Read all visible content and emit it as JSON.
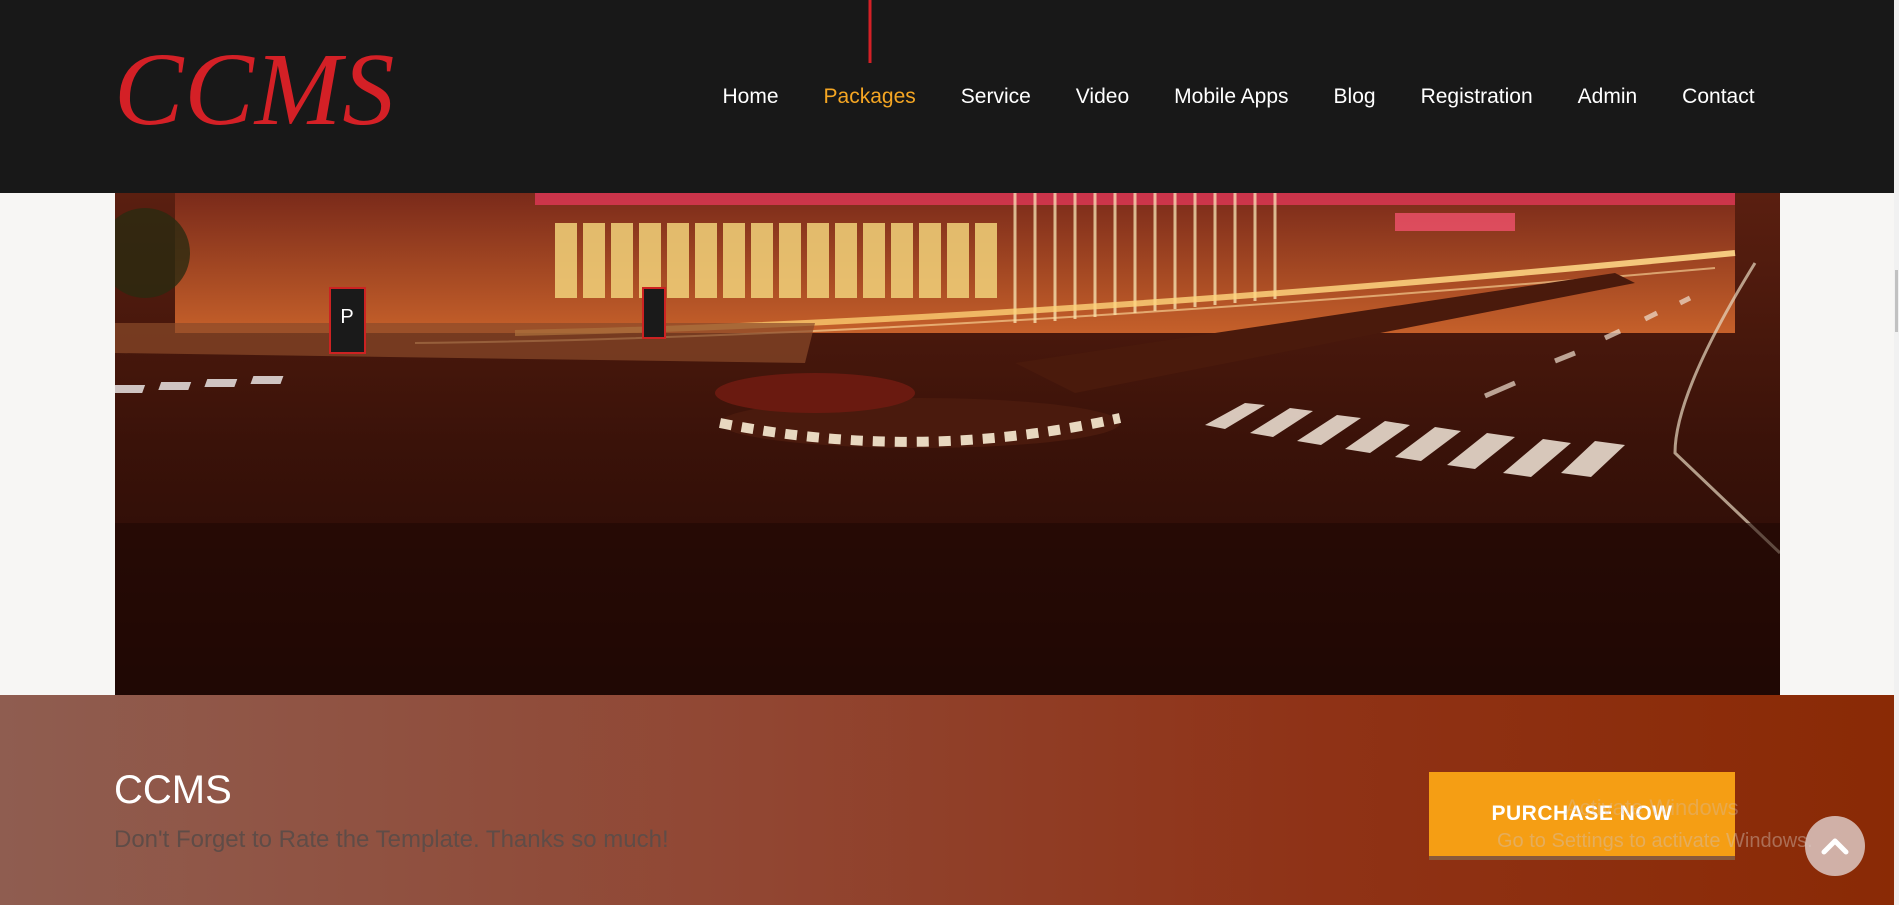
{
  "header": {
    "logo": "CCMS",
    "nav": [
      {
        "label": "Home"
      },
      {
        "label": "Packages",
        "active": true
      },
      {
        "label": "Service"
      },
      {
        "label": "Video"
      },
      {
        "label": "Mobile Apps"
      },
      {
        "label": "Blog"
      },
      {
        "label": "Registration"
      },
      {
        "label": "Admin"
      },
      {
        "label": "Contact"
      }
    ]
  },
  "hero": {
    "image": "night street scene with parking lot, mall building and crosswalks"
  },
  "footer": {
    "title": "CCMS",
    "subtitle": "Don't Forget to Rate the Template. Thanks so much!",
    "purchase_label": "PURCHASE NOW",
    "watermark_line1": "Activate Windows",
    "watermark_line2": "Go to Settings to activate Windows.",
    "scroll_top_icon": "chevron-up-icon"
  },
  "colors": {
    "header_bg": "#181818",
    "logo": "#d42026",
    "active_nav": "#f5a623",
    "button": "#f59e14"
  }
}
